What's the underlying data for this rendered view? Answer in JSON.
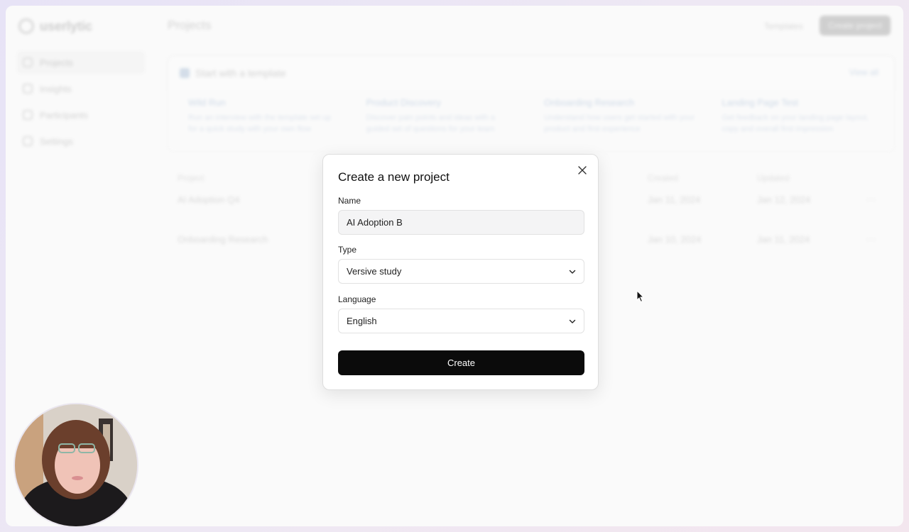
{
  "app": {
    "logo_text": "userlytic",
    "page_title": "Projects",
    "top_link": "Templates",
    "top_button": "Create project"
  },
  "sidebar": {
    "items": [
      {
        "label": "Projects",
        "active": true
      },
      {
        "label": "Insights",
        "active": false
      },
      {
        "label": "Participants",
        "active": false
      },
      {
        "label": "Settings",
        "active": false
      }
    ]
  },
  "templates": {
    "title": "Start with a template",
    "view_all": "View all",
    "items": [
      {
        "title": "Wild Run",
        "desc": "Run an interview with the template set up for a quick study with your own flow"
      },
      {
        "title": "Product Discovery",
        "desc": "Discover pain points and ideas with a guided set of questions for your team"
      },
      {
        "title": "Onboarding Research",
        "desc": "Understand how users get started with your product and first experience"
      },
      {
        "title": "Landing Page Test",
        "desc": "Get feedback on your landing page layout, copy and overall first impression"
      }
    ]
  },
  "projects_table": {
    "headers": {
      "name": "Project",
      "created": "Created",
      "updated": "Updated"
    },
    "rows": [
      {
        "name": "AI Adoption Q4",
        "created": "Jan 11, 2024",
        "updated": "Jan 12, 2024"
      },
      {
        "name": "Onboarding Research",
        "created": "Jan 10, 2024",
        "updated": "Jan 11, 2024"
      }
    ]
  },
  "modal": {
    "title": "Create a new project",
    "name_label": "Name",
    "name_value": "AI Adoption B",
    "type_label": "Type",
    "type_value": "Versive study",
    "language_label": "Language",
    "language_value": "English",
    "create_button": "Create"
  },
  "icons": {
    "close": "close-icon",
    "chevron": "chevron-down-icon",
    "cursor": "mouse-cursor-icon"
  },
  "colors": {
    "primary_button": "#0b0b0b",
    "accent": "#7a9cc4"
  }
}
